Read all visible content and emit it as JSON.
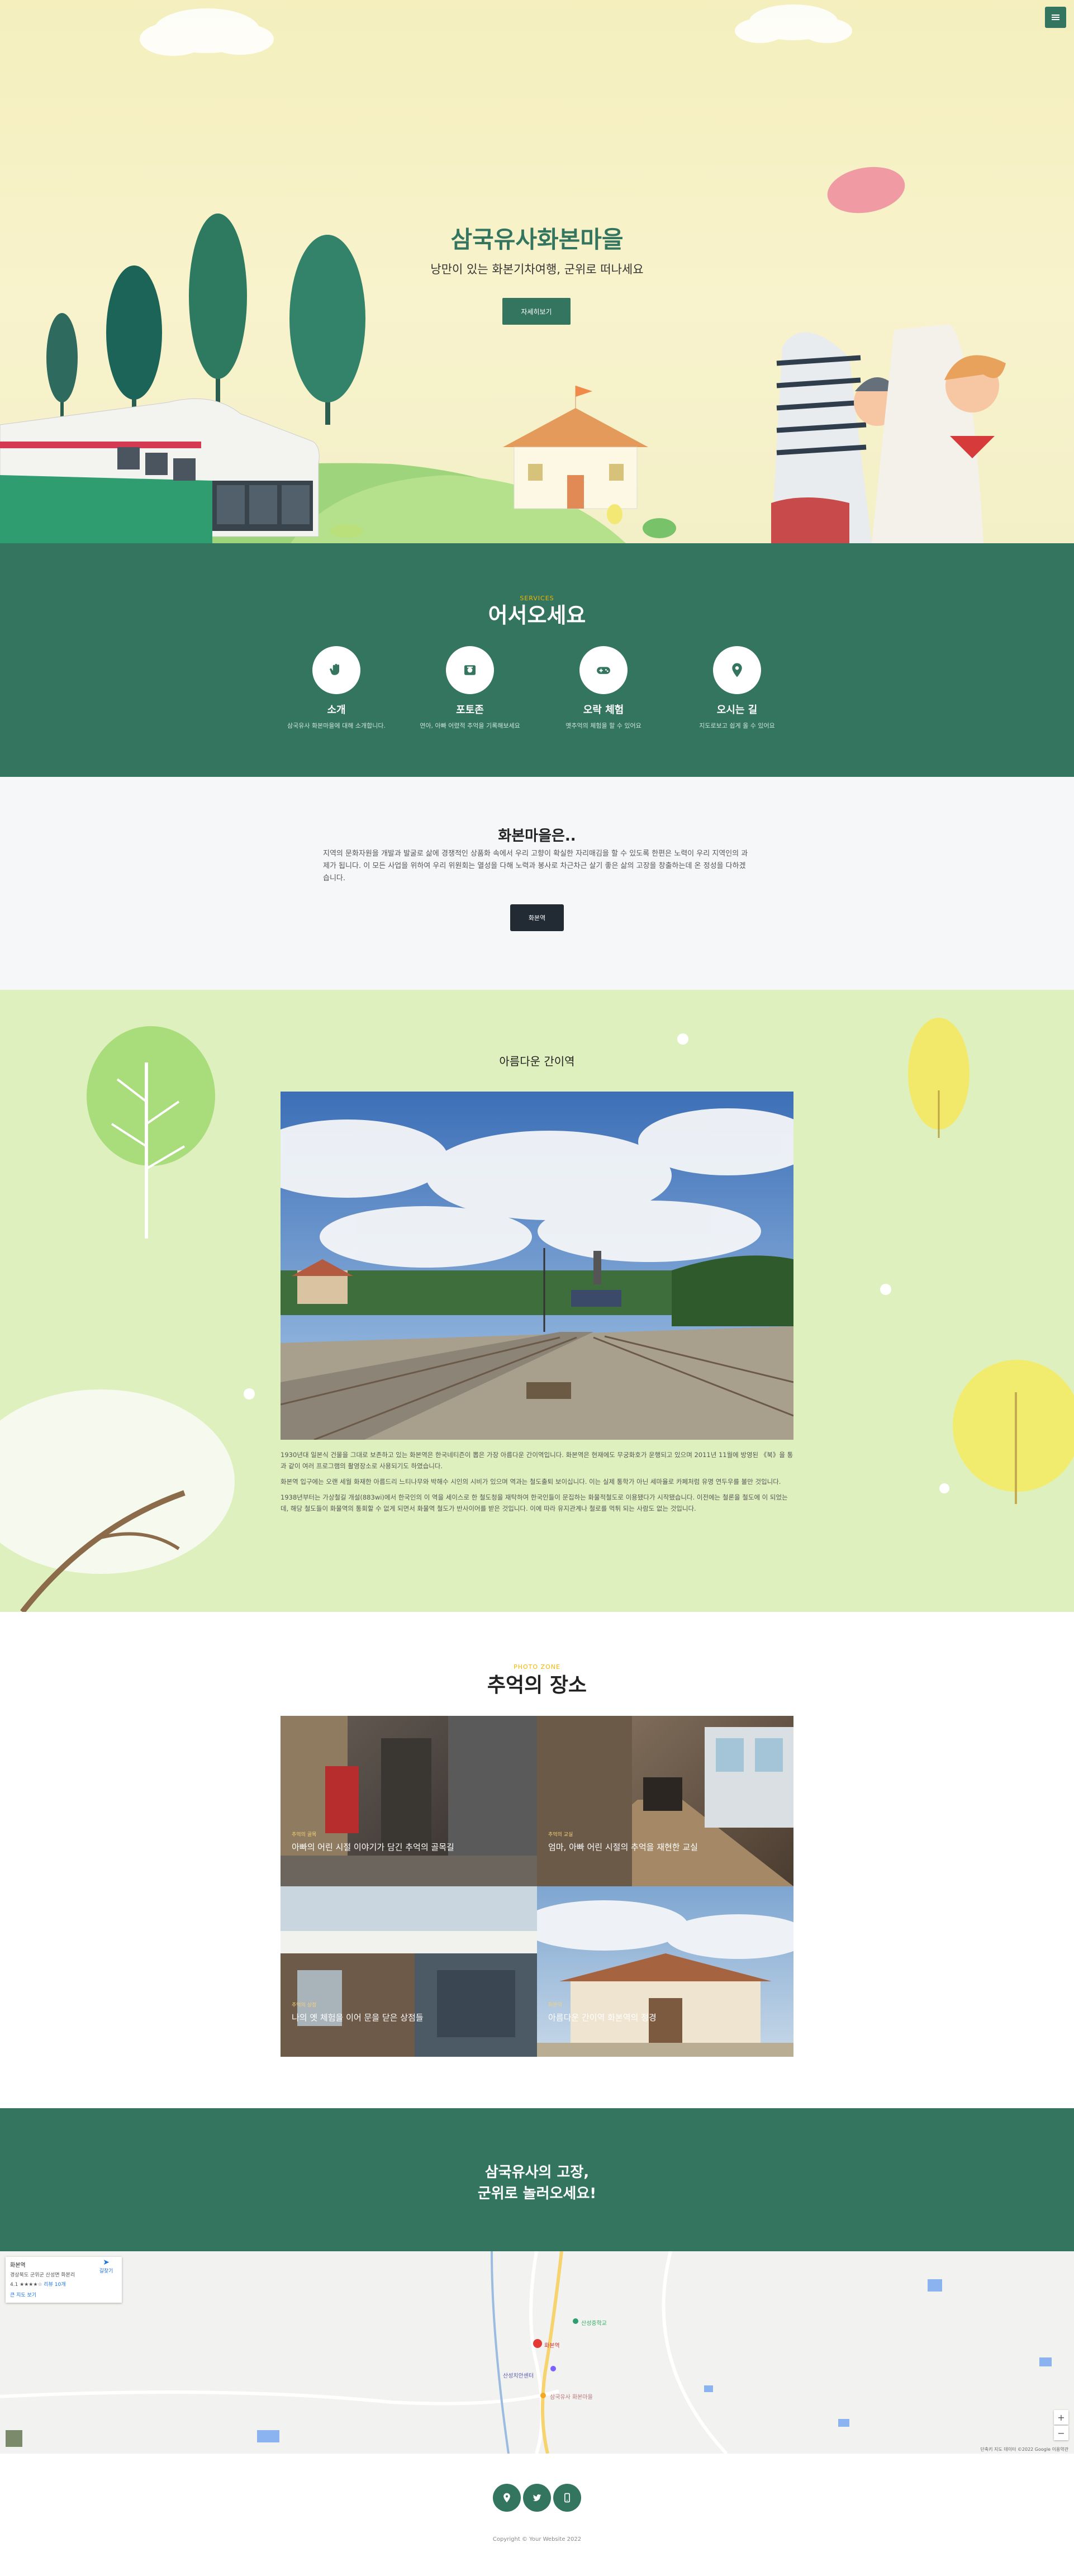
{
  "menu": {
    "icon": "hamburger-icon"
  },
  "hero": {
    "title": "삼국유사화본마을",
    "subtitle": "낭만이 있는 화본기차여행, 군위로 떠나세요",
    "button": "자세히보기"
  },
  "welcome": {
    "kicker": "SERVICES",
    "title": "어서오세요",
    "features": [
      {
        "icon": "hand-wave-icon",
        "title": "소개",
        "desc": "삼국유사 화본마을에 대해 소개합니다."
      },
      {
        "icon": "photo-booth-icon",
        "title": "포토존",
        "desc": "연아, 아빠 어렸적 추억을 기록해보세요"
      },
      {
        "icon": "gamepad-icon",
        "title": "오락 체험",
        "desc": "옛추억의 체험을 할 수 있어요"
      },
      {
        "icon": "map-pin-icon",
        "title": "오시는 길",
        "desc": "지도로보고 쉽게 올 수 있어요"
      }
    ]
  },
  "about": {
    "title": "화본마을은..",
    "text": "지역의 문화자원을 개발과 발굴로 삶에 경쟁적인 상품화 속에서 우리 고향이 확실한 자리매김을 할 수 있도록 한편은 노력이 우리 지역인의 과제가 됩니다. 이 모든 사업을 위하여 우리 위원회는 열성을 다해 노력과 봉사로 차근차근 살기 좋은 삶의 고장을 창출하는데 온 정성을 다하겠습니다.",
    "button": "화본역"
  },
  "scenery": {
    "title": "아름다운 간이역",
    "paragraphs": [
      "1930년대 일본식 건물을 그대로 보존하고 있는 화본역은 한국네티즌이 뽑은 가장 아름다운 간이역입니다. 화본역은 현재에도 무궁화호가 운행되고 있으며 2011년 11월에 방영된 《북》을 통과 같이 여러 프로그램의 촬영장소로 사용되기도 하였습니다.",
      "화본역 입구에는 오랜 세월 화재한 아름드리 느티나무와 박해수 시인의 시비가 있으며 역과는 철도출퇴 보이십니다. 이는 실제 통학가 아닌 세마율로 카페처럼 유명 연두우를 볼만 것입니다.",
      "1938년부터는 가상철길 개설(883wi)에서 한국인의 이 역을 세이스로 한 철도청을 재탁하여 한국인들이 문집하는 화물적철도로 이용됐다가 시작됐습니다. 이전에는 철론을 철도에 이 되었는데, 해당 철도들이 화물역의 통회할 수 없게 되면서 화물역 철도가 반사이어를 받은 것입니다. 이에 따라 유지관계나 철로를 먹튀 되는 사람도 없는 것입니다."
    ]
  },
  "memory": {
    "kicker": "PHOTO ZONE",
    "title": "추억의 장소",
    "tiles": [
      {
        "cat": "추억의 골목",
        "name": "아빠의 어린 시절 이야기가 담긴 추억의 골목길"
      },
      {
        "cat": "추억의 교실",
        "name": "엄마, 아빠 어린 시절의 추억을 재현한 교실"
      },
      {
        "cat": "추억의 상점",
        "name": "나의 옛 체험을 이어 문을 닫은 상점들"
      },
      {
        "cat": "화본역",
        "name": "아름다운 간이역 화본역의 정경"
      }
    ]
  },
  "cta": {
    "line1": "삼국유사의 고장,",
    "line2": "군위로 놀러오세요!"
  },
  "map": {
    "place": "화본역",
    "address": "경상북도 군위군 산성면 화본리",
    "rating": "4.1 ★★★★☆",
    "reviews": "리뷰 10개",
    "link": "큰 지도 보기",
    "directions": "길찾기",
    "labels": [
      "화본역",
      "산성중학교",
      "산성치안센터",
      "삼국유사 화본마을"
    ],
    "footer": "단축키 지도 데이터 ©2022 Google 이용약관"
  },
  "footer": {
    "icons": [
      "map-pin-icon",
      "twitter-icon",
      "mobile-icon"
    ],
    "copyright": "Copyright © Your Website 2022"
  },
  "colors": {
    "primary": "#347560",
    "accent": "#f5b400",
    "scenery_bg": "#dff0bf",
    "hero_bg": "#f6f1c6"
  }
}
